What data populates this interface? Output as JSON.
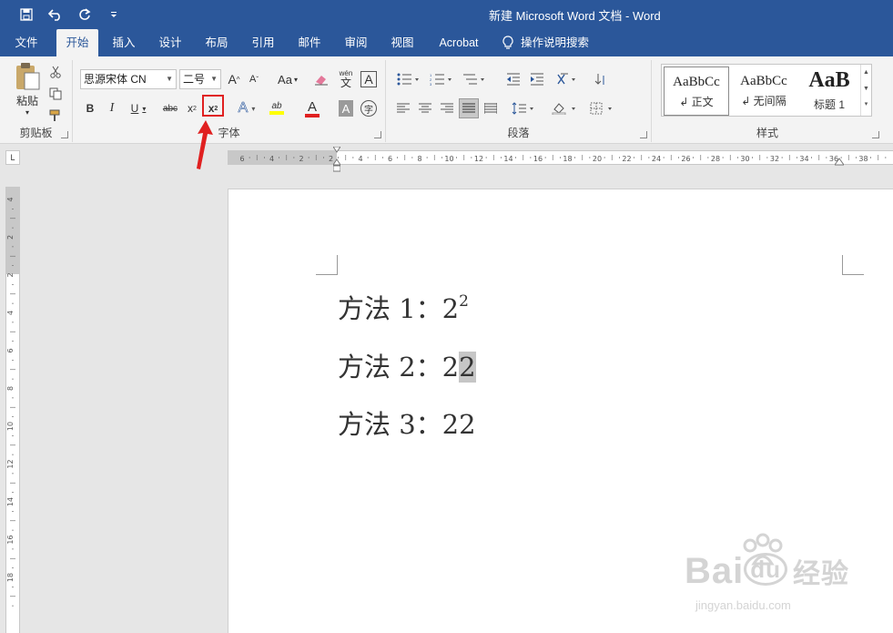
{
  "window": {
    "title": "新建 Microsoft Word 文档  -  Word"
  },
  "qat": {
    "icons": [
      "save-icon",
      "undo-icon",
      "redo-icon",
      "customize-icon"
    ]
  },
  "tabs": [
    {
      "label": "文件",
      "active": false
    },
    {
      "label": "开始",
      "active": true
    },
    {
      "label": "插入",
      "active": false
    },
    {
      "label": "设计",
      "active": false
    },
    {
      "label": "布局",
      "active": false
    },
    {
      "label": "引用",
      "active": false
    },
    {
      "label": "邮件",
      "active": false
    },
    {
      "label": "审阅",
      "active": false
    },
    {
      "label": "视图",
      "active": false
    },
    {
      "label": "Acrobat",
      "active": false
    }
  ],
  "tellme": {
    "label": "操作说明搜索"
  },
  "clipboard": {
    "paste_label": "粘贴",
    "group_label": "剪贴板"
  },
  "font": {
    "name": "思源宋体 CN",
    "size": "二号",
    "group_label": "字体",
    "bold": "B",
    "italic": "I",
    "underline": "U",
    "strikethrough": "abc",
    "subscript_base": "x",
    "subscript_mark": "2",
    "superscript_base": "x",
    "superscript_mark": "2",
    "grow": "A",
    "shrink": "A",
    "case": "Aa",
    "phonetic_top": "wén",
    "phonetic_bottom": "文",
    "border_char": "A",
    "effects": "A",
    "font_color": "A",
    "shading": "A",
    "enclose": "字",
    "highlight_mark": "ab"
  },
  "paragraph": {
    "group_label": "段落"
  },
  "styles": {
    "group_label": "样式",
    "items": [
      {
        "preview": "AaBbCc",
        "name": "↲ 正文"
      },
      {
        "preview": "AaBbCc",
        "name": "↲ 无间隔"
      },
      {
        "preview": "AaB",
        "name": "标题 1"
      }
    ]
  },
  "ruler": {
    "tab_selector": "L",
    "h_labels": [
      "6",
      "4",
      "2",
      "2",
      "4",
      "6",
      "8",
      "10",
      "12",
      "14",
      "16",
      "18",
      "20",
      "22",
      "24",
      "26",
      "28",
      "30",
      "32",
      "34",
      "36",
      "38"
    ],
    "v_labels": [
      "4",
      "2",
      "2",
      "4",
      "6",
      "8",
      "10",
      "12",
      "14",
      "16",
      "18"
    ]
  },
  "document": {
    "lines": [
      {
        "label": "方法 1：",
        "base": "2",
        "extra": "2",
        "mode": "superscript"
      },
      {
        "label": "方法 2：",
        "base": "2",
        "extra": "2",
        "mode": "highlight"
      },
      {
        "label": "方法 3：",
        "base": "2",
        "extra": "2",
        "mode": "plain"
      }
    ]
  },
  "watermark": {
    "brand": "Bai",
    "brand_mid": "du",
    "brand_cn": "经验",
    "url": "jingyan.baidu.com"
  },
  "colors": {
    "accent": "#2b579a",
    "ribbon": "#f3f3f3",
    "highlight_red": "#e02020"
  }
}
